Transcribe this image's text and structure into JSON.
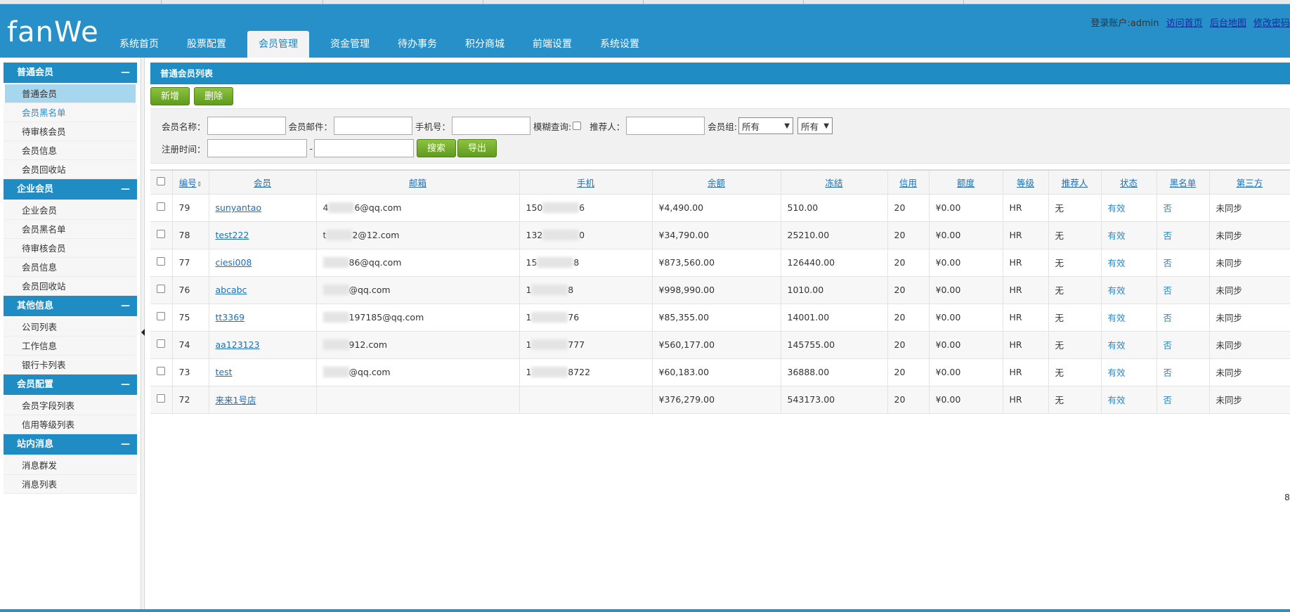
{
  "header": {
    "logo": "fanWe",
    "nav": [
      "系统首页",
      "股票配置",
      "会员管理",
      "资金管理",
      "待办事务",
      "积分商城",
      "前端设置",
      "系统设置"
    ],
    "user_label": "登录账户:admin",
    "links": [
      "访问首页",
      "后台地图",
      "修改密码"
    ]
  },
  "sidebar": {
    "groups": [
      {
        "title": "普通会员",
        "items": [
          "普通会员",
          "会员黑名单",
          "待审核会员",
          "会员信息",
          "会员回收站"
        ]
      },
      {
        "title": "企业会员",
        "items": [
          "企业会员",
          "会员黑名单",
          "待审核会员",
          "会员信息",
          "会员回收站"
        ]
      },
      {
        "title": "其他信息",
        "items": [
          "公司列表",
          "工作信息",
          "银行卡列表"
        ]
      },
      {
        "title": "会员配置",
        "items": [
          "会员字段列表",
          "信用等级列表"
        ]
      },
      {
        "title": "站内消息",
        "items": [
          "消息群发",
          "消息列表"
        ]
      }
    ],
    "collapse_symbol": "—"
  },
  "main": {
    "panel_title": "普通会员列表",
    "add_label": "新增",
    "delete_label": "删除",
    "filter": {
      "name_label": "会员名称：",
      "email_label": "会员邮件：",
      "phone_label": "手机号：",
      "fuzzy_label": "模糊查询:",
      "referrer_label": "推荐人：",
      "group_label": "会员组:",
      "group_value": "所有",
      "level_value": "所有",
      "reg_time_label": "注册时间：",
      "dash": "-",
      "search_label": "搜索",
      "export_label": "导出"
    },
    "columns": [
      "编号",
      "会员",
      "邮箱",
      "手机",
      "余额",
      "冻结",
      "信用",
      "额度",
      "等级",
      "推荐人",
      "状态",
      "黑名单",
      "第三方"
    ],
    "rows": [
      {
        "id": "79",
        "user": "sunyantao",
        "email_a": "4",
        "email_b": "6@qq.com",
        "phone_a": "150",
        "phone_b": "6",
        "balance": "¥4,490.00",
        "frozen": "510.00",
        "credit": "20",
        "quota": "¥0.00",
        "level": "HR",
        "ref": "无",
        "status": "有效",
        "black": "否",
        "third": "未同步"
      },
      {
        "id": "78",
        "user": "test222",
        "email_a": "t",
        "email_b": "2@12.com",
        "phone_a": "132",
        "phone_b": "0",
        "balance": "¥34,790.00",
        "frozen": "25210.00",
        "credit": "20",
        "quota": "¥0.00",
        "level": "HR",
        "ref": "无",
        "status": "有效",
        "black": "否",
        "third": "未同步"
      },
      {
        "id": "77",
        "user": "ciesi008",
        "email_a": "",
        "email_b": "86@qq.com",
        "phone_a": "15",
        "phone_b": "8",
        "balance": "¥873,560.00",
        "frozen": "126440.00",
        "credit": "20",
        "quota": "¥0.00",
        "level": "HR",
        "ref": "无",
        "status": "有效",
        "black": "否",
        "third": "未同步"
      },
      {
        "id": "76",
        "user": "abcabc",
        "email_a": "",
        "email_b": "@qq.com",
        "phone_a": "1",
        "phone_b": "8",
        "balance": "¥998,990.00",
        "frozen": "1010.00",
        "credit": "20",
        "quota": "¥0.00",
        "level": "HR",
        "ref": "无",
        "status": "有效",
        "black": "否",
        "third": "未同步"
      },
      {
        "id": "75",
        "user": "tt3369",
        "email_a": "",
        "email_b": "197185@qq.com",
        "phone_a": "1",
        "phone_b": "76",
        "balance": "¥85,355.00",
        "frozen": "14001.00",
        "credit": "20",
        "quota": "¥0.00",
        "level": "HR",
        "ref": "无",
        "status": "有效",
        "black": "否",
        "third": "未同步"
      },
      {
        "id": "74",
        "user": "aa123123",
        "email_a": "",
        "email_b": "912.com",
        "phone_a": "1",
        "phone_b": "777",
        "balance": "¥560,177.00",
        "frozen": "145755.00",
        "credit": "20",
        "quota": "¥0.00",
        "level": "HR",
        "ref": "无",
        "status": "有效",
        "black": "否",
        "third": "未同步"
      },
      {
        "id": "73",
        "user": "test",
        "email_a": "",
        "email_b": "@qq.com",
        "phone_a": "1",
        "phone_b": "8722",
        "balance": "¥60,183.00",
        "frozen": "36888.00",
        "credit": "20",
        "quota": "¥0.00",
        "level": "HR",
        "ref": "无",
        "status": "有效",
        "black": "否",
        "third": "未同步"
      },
      {
        "id": "72",
        "user": "来来1号店",
        "email_a": "",
        "email_b": "",
        "phone_a": "",
        "phone_b": "",
        "balance": "¥376,279.00",
        "frozen": "543173.00",
        "credit": "20",
        "quota": "¥0.00",
        "level": "HR",
        "ref": "无",
        "status": "有效",
        "black": "否",
        "third": "未同步"
      }
    ],
    "pager_text": "8"
  },
  "colors": {
    "brand_blue": "#2790c8",
    "button_green": "#6aa82a",
    "link_blue": "#1f6fb5"
  }
}
